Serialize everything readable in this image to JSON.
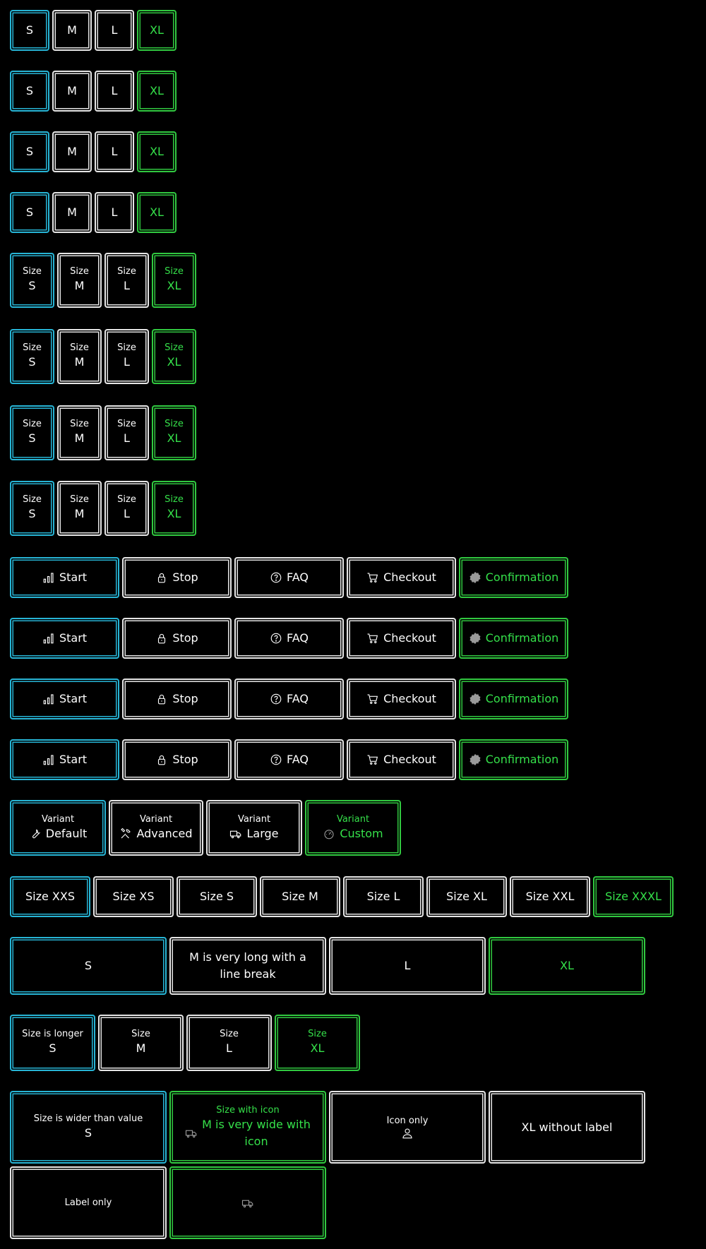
{
  "colors": {
    "background": "#000000",
    "default_border": "#e6e6e6",
    "focused_border": "#27b5d6",
    "selected_border": "#31c940",
    "selected_text": "#35e04a"
  },
  "simple_groups": [
    {
      "options": [
        "S",
        "M",
        "L",
        "XL"
      ]
    },
    {
      "options": [
        "S",
        "M",
        "L",
        "XL"
      ]
    },
    {
      "options": [
        "S",
        "M",
        "L",
        "XL"
      ]
    },
    {
      "options": [
        "S",
        "M",
        "L",
        "XL"
      ]
    }
  ],
  "labeled_groups": [
    {
      "options": [
        {
          "label": "Size",
          "value": "S"
        },
        {
          "label": "Size",
          "value": "M"
        },
        {
          "label": "Size",
          "value": "L"
        },
        {
          "label": "Size",
          "value": "XL"
        }
      ]
    },
    {
      "options": [
        {
          "label": "Size",
          "value": "S"
        },
        {
          "label": "Size",
          "value": "M"
        },
        {
          "label": "Size",
          "value": "L"
        },
        {
          "label": "Size",
          "value": "XL"
        }
      ]
    },
    {
      "options": [
        {
          "label": "Size",
          "value": "S"
        },
        {
          "label": "Size",
          "value": "M"
        },
        {
          "label": "Size",
          "value": "L"
        },
        {
          "label": "Size",
          "value": "XL"
        }
      ]
    },
    {
      "options": [
        {
          "label": "Size",
          "value": "S"
        },
        {
          "label": "Size",
          "value": "M"
        },
        {
          "label": "Size",
          "value": "L"
        },
        {
          "label": "Size",
          "value": "XL"
        }
      ]
    }
  ],
  "icon_groups": [
    {
      "options": [
        {
          "icon": "signal-bars-icon",
          "value": "Start"
        },
        {
          "icon": "lock-icon",
          "value": "Stop"
        },
        {
          "icon": "question-circle-icon",
          "value": "FAQ"
        },
        {
          "icon": "cart-icon",
          "value": "Checkout"
        },
        {
          "icon": "badge-star-icon",
          "value": "Confirmation"
        }
      ]
    },
    {
      "options": [
        {
          "icon": "signal-bars-icon",
          "value": "Start"
        },
        {
          "icon": "lock-icon",
          "value": "Stop"
        },
        {
          "icon": "question-circle-icon",
          "value": "FAQ"
        },
        {
          "icon": "cart-icon",
          "value": "Checkout"
        },
        {
          "icon": "badge-star-icon",
          "value": "Confirmation"
        }
      ]
    },
    {
      "options": [
        {
          "icon": "signal-bars-icon",
          "value": "Start"
        },
        {
          "icon": "lock-icon",
          "value": "Stop"
        },
        {
          "icon": "question-circle-icon",
          "value": "FAQ"
        },
        {
          "icon": "cart-icon",
          "value": "Checkout"
        },
        {
          "icon": "badge-star-icon",
          "value": "Confirmation"
        }
      ]
    },
    {
      "options": [
        {
          "icon": "signal-bars-icon",
          "value": "Start"
        },
        {
          "icon": "lock-icon",
          "value": "Stop"
        },
        {
          "icon": "question-circle-icon",
          "value": "FAQ"
        },
        {
          "icon": "cart-icon",
          "value": "Checkout"
        },
        {
          "icon": "badge-star-icon",
          "value": "Confirmation"
        }
      ]
    }
  ],
  "variant_group": {
    "options": [
      {
        "label": "Variant",
        "icon": "wrench-icon",
        "value": "Default"
      },
      {
        "label": "Variant",
        "icon": "tools-icon",
        "value": "Advanced"
      },
      {
        "label": "Variant",
        "icon": "truck-icon",
        "value": "Large"
      },
      {
        "label": "Variant",
        "icon": "gauge-icon",
        "value": "Custom"
      }
    ]
  },
  "size_text_group": {
    "options": [
      "Size XXS",
      "Size XS",
      "Size S",
      "Size M",
      "Size L",
      "Size XL",
      "Size XXL",
      "Size XXXL"
    ]
  },
  "wide_group": {
    "options": [
      "S",
      "M is very long with a line break",
      "L",
      "XL"
    ]
  },
  "longer_label_group": {
    "options": [
      {
        "label": "Size is longer",
        "value": "S"
      },
      {
        "label": "Size",
        "value": "M"
      },
      {
        "label": "Size",
        "value": "L"
      },
      {
        "label": "Size",
        "value": "XL"
      }
    ]
  },
  "mixed_group": {
    "options": [
      {
        "label": "Size is wider than value",
        "value": "S"
      },
      {
        "label": "Size with icon",
        "icon": "truck-icon",
        "value": "M is very wide with icon"
      },
      {
        "label": "Icon only",
        "icon": "user-icon",
        "value": ""
      },
      {
        "label": "",
        "value": "XL without label"
      },
      {
        "label": "Label only",
        "value": ""
      },
      {
        "label": "",
        "icon": "truck-icon",
        "value": ""
      }
    ]
  }
}
